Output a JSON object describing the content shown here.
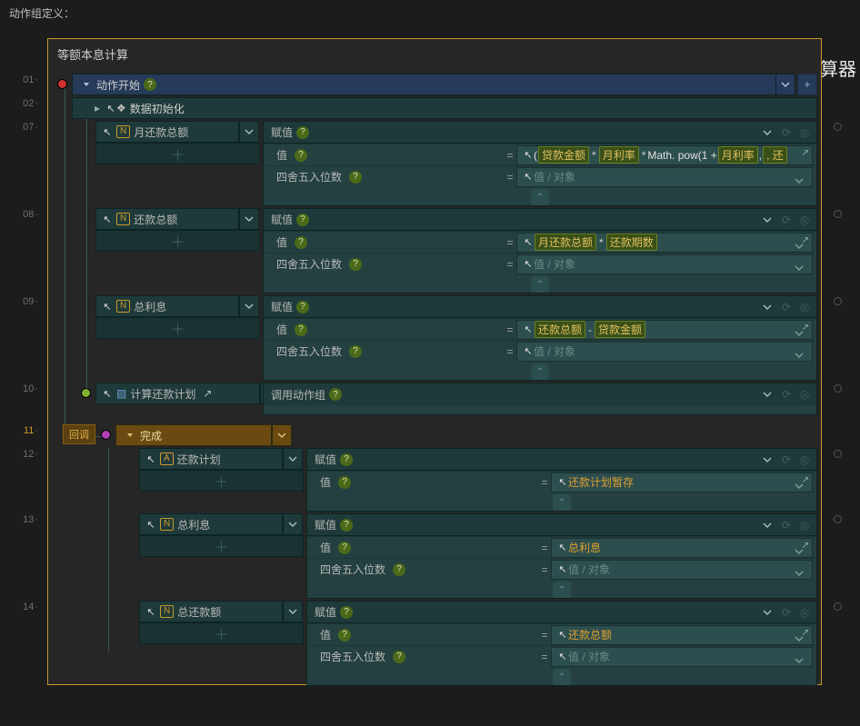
{
  "header_label": "动作组定义：",
  "group_title": "等额本息计算",
  "action_start": "动作开始",
  "line_numbers": [
    "01",
    "02",
    "07",
    "08",
    "09",
    "10",
    "11",
    "12",
    "13",
    "14"
  ],
  "data_init": "数据初始化",
  "callback_label": "回调",
  "done_label": "完成",
  "invoke_label": "调用动作组",
  "assign_label": "赋值",
  "value_label": "值",
  "round_label": "四舍五入位数",
  "placeholder": "值 / 对象",
  "nodes": {
    "n07": {
      "tag": "N",
      "name": "月还款总额"
    },
    "n08": {
      "tag": "N",
      "name": "还款总额"
    },
    "n09": {
      "tag": "N",
      "name": "总利息"
    },
    "n10": {
      "name": "计算还款计划"
    },
    "n12": {
      "tag": "A",
      "name": "还款计划"
    },
    "n13": {
      "tag": "N",
      "name": "总利息"
    },
    "n14": {
      "tag": "N",
      "name": "总还款额"
    }
  },
  "expr07": {
    "open": "(",
    "v1": "贷款金额",
    "v2": "月利率",
    "fn": "Math. pow(1  +",
    "v3": "月利率",
    "tail": ",  还"
  },
  "expr08": {
    "v1": "月还款总额",
    "v2": "还款期数"
  },
  "expr09": {
    "v1": "还款总额",
    "v2": "贷款金额"
  },
  "expr12": {
    "v1": "还款计划暂存"
  },
  "expr13": {
    "v1": "总利息"
  },
  "expr14": {
    "v1": "还款总额"
  },
  "side_char": "算器"
}
